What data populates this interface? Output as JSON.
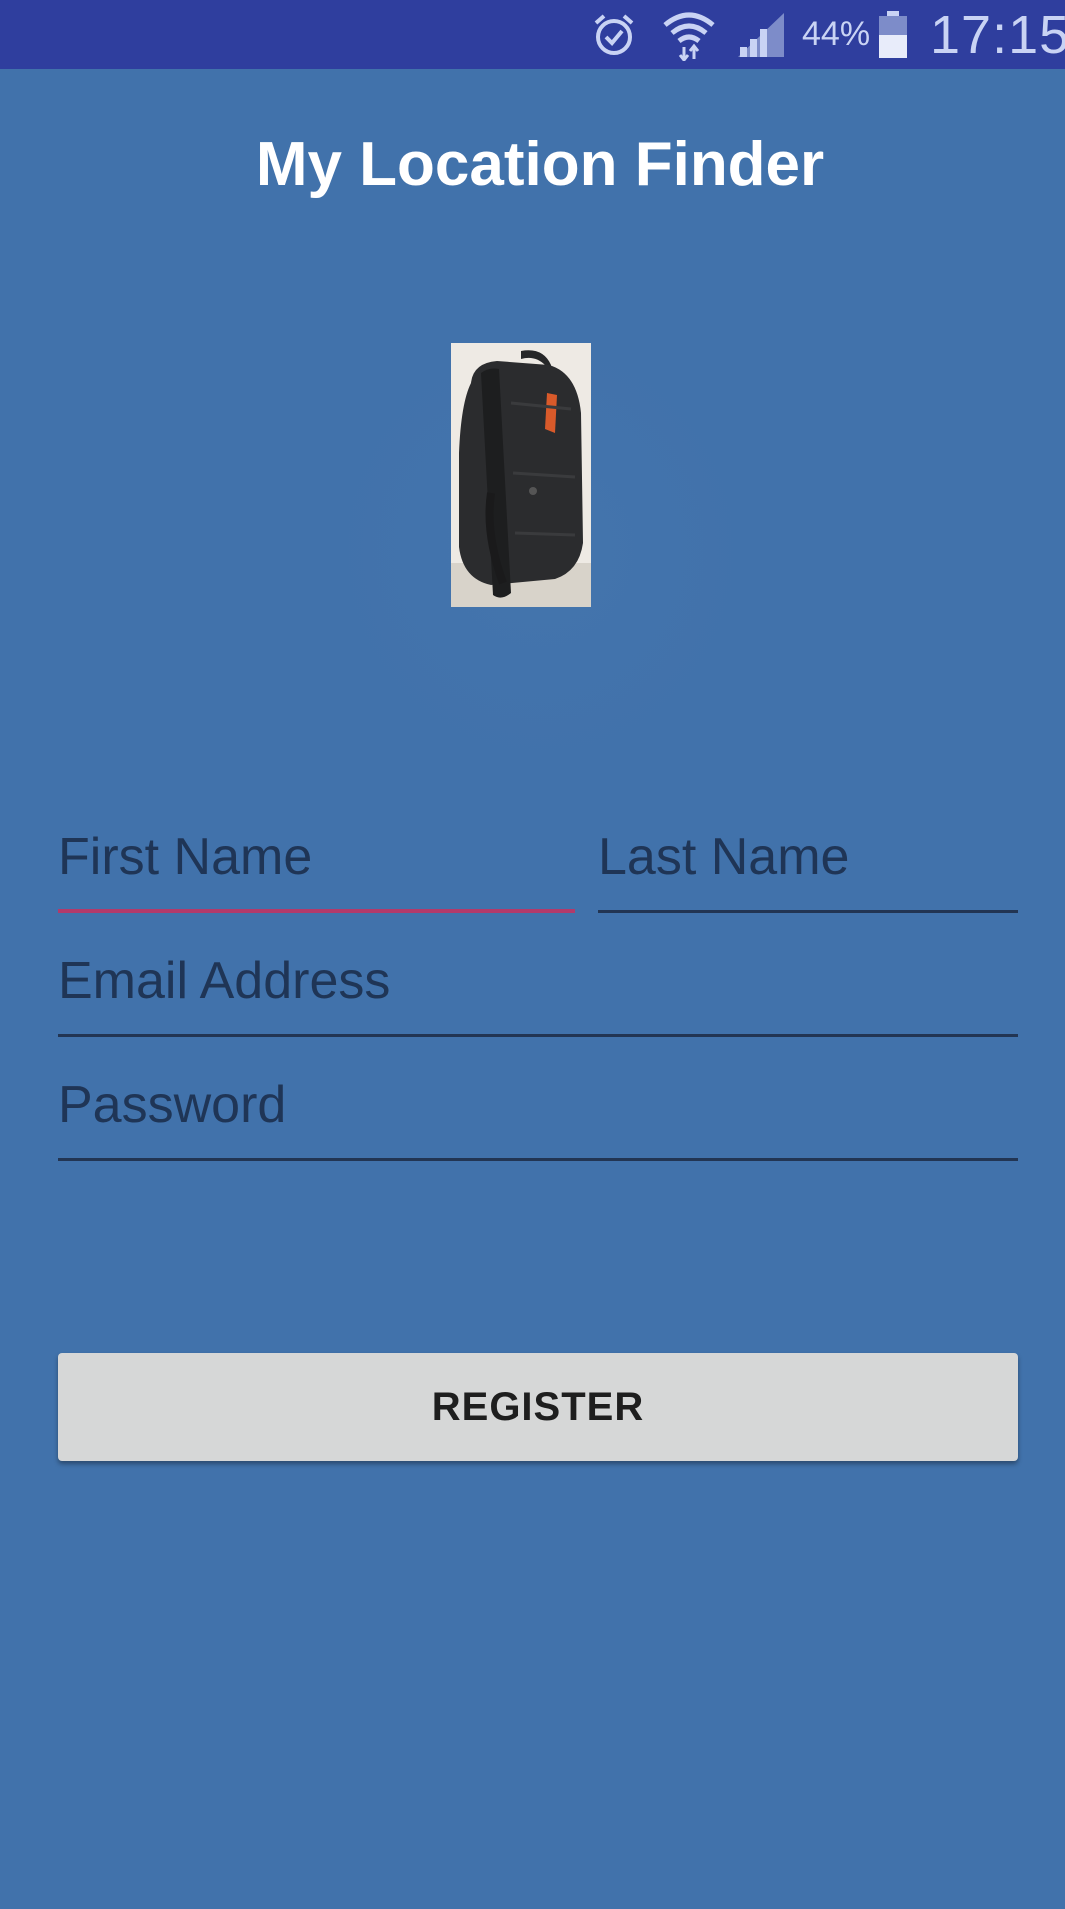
{
  "status_bar": {
    "battery_percent": "44%",
    "battery_level": 0.44,
    "clock": "17:15",
    "icons": [
      "alarm-icon",
      "wifi-icon",
      "signal-icon",
      "battery-icon"
    ]
  },
  "header": {
    "title": "My Location Finder"
  },
  "form": {
    "first_name": {
      "placeholder": "First Name",
      "value": ""
    },
    "last_name": {
      "placeholder": "Last Name",
      "value": ""
    },
    "email": {
      "placeholder": "Email Address",
      "value": ""
    },
    "password": {
      "placeholder": "Password",
      "value": ""
    }
  },
  "actions": {
    "register_label": "REGISTER"
  },
  "colors": {
    "background": "#4172AB",
    "status_bar": "#2F3E9E",
    "focused_underline": "#B23A6B",
    "button": "#D6D7D7"
  }
}
